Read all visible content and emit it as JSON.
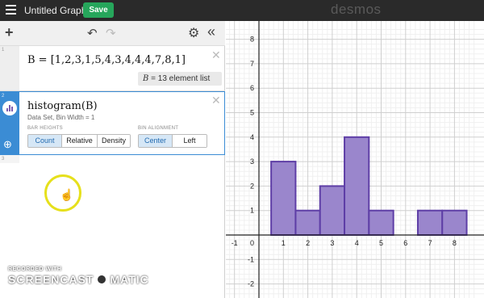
{
  "topbar": {
    "title": "Untitled Graph",
    "save_label": "Save",
    "brand": "desmos"
  },
  "toolbar": {
    "add_icon": "plus-icon",
    "undo_icon": "undo-icon",
    "redo_icon": "redo-icon",
    "settings_icon": "gear-icon",
    "collapse_icon": "double-chevron-left-icon"
  },
  "expressions": [
    {
      "index": "1",
      "latex": "B = [1,2,3,1,5,4,3,4,4,4,7,8,1]",
      "eval_var": "B",
      "eval_text": "= 13 element list"
    },
    {
      "index": "2",
      "latex": "histogram(B)",
      "subtitle": "Data Set, Bin Width = 1",
      "bar_heights_label": "BAR HEIGHTS",
      "bar_heights_options": [
        "Count",
        "Relative",
        "Density"
      ],
      "bar_heights_selected": "Count",
      "bin_alignment_label": "BIN ALIGNMENT",
      "bin_alignment_options": [
        "Center",
        "Left"
      ],
      "bin_alignment_selected": "Center"
    },
    {
      "index": "3"
    }
  ],
  "watermark": {
    "top": "RECORDED WITH",
    "left": "SCREENCAST",
    "right": "MATIC"
  },
  "chart_data": {
    "type": "bar",
    "bin_width": 1,
    "bins": [
      {
        "center": 1,
        "count": 3
      },
      {
        "center": 2,
        "count": 1
      },
      {
        "center": 3,
        "count": 2
      },
      {
        "center": 4,
        "count": 4
      },
      {
        "center": 5,
        "count": 1
      },
      {
        "center": 7,
        "count": 1
      },
      {
        "center": 8,
        "count": 1
      }
    ],
    "xlim": [
      -1.6,
      8.8
    ],
    "ylim": [
      -2.5,
      8.4
    ],
    "x_ticks": [
      -1,
      1,
      2,
      3,
      4,
      5,
      6,
      7,
      8
    ],
    "y_ticks": [
      -2,
      -1,
      1,
      2,
      3,
      4,
      5,
      6,
      7,
      8
    ],
    "origin_label": "0",
    "grid": true,
    "bar_color": "#9a86cc",
    "bar_stroke": "#5e3ea6"
  }
}
